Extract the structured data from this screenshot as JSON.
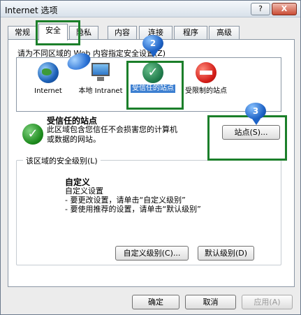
{
  "window": {
    "title": "Internet 选项",
    "help_label": "?",
    "close_label": "X"
  },
  "tabs": [
    "常规",
    "安全",
    "隐私",
    "内容",
    "连接",
    "程序",
    "高级"
  ],
  "zones_prompt": "请为不同区域的 Web 内容指定安全设置(Z)",
  "zones": [
    {
      "label": "Internet",
      "icon": "globe-icon"
    },
    {
      "label": "本地 Intranet",
      "icon": "monitor-icon"
    },
    {
      "label": "受信任的站点",
      "icon": "check-icon"
    },
    {
      "label": "受限制的站点",
      "icon": "no-entry-icon"
    }
  ],
  "selected_zone": {
    "title": "受信任的站点",
    "description": "此区域包含您信任不会损害您的计算机或数据的网站。"
  },
  "sites_button": "站点(S)...",
  "security_level": {
    "legend": "该区域的安全级别(L)",
    "title": "自定义",
    "lines": [
      "自定义设置",
      "- 要更改设置，请单击“自定义级别”",
      "- 要使用推荐的设置，请单击“默认级别”"
    ],
    "custom_button": "自定义级别(C)...",
    "default_button": "默认级别(D)"
  },
  "footer": {
    "ok": "确定",
    "cancel": "取消",
    "apply": "应用(A)"
  },
  "callouts": {
    "two": "2",
    "three": "3"
  },
  "colors": {
    "highlight": "#1b7f2a",
    "selection": "#3c7fd1"
  }
}
